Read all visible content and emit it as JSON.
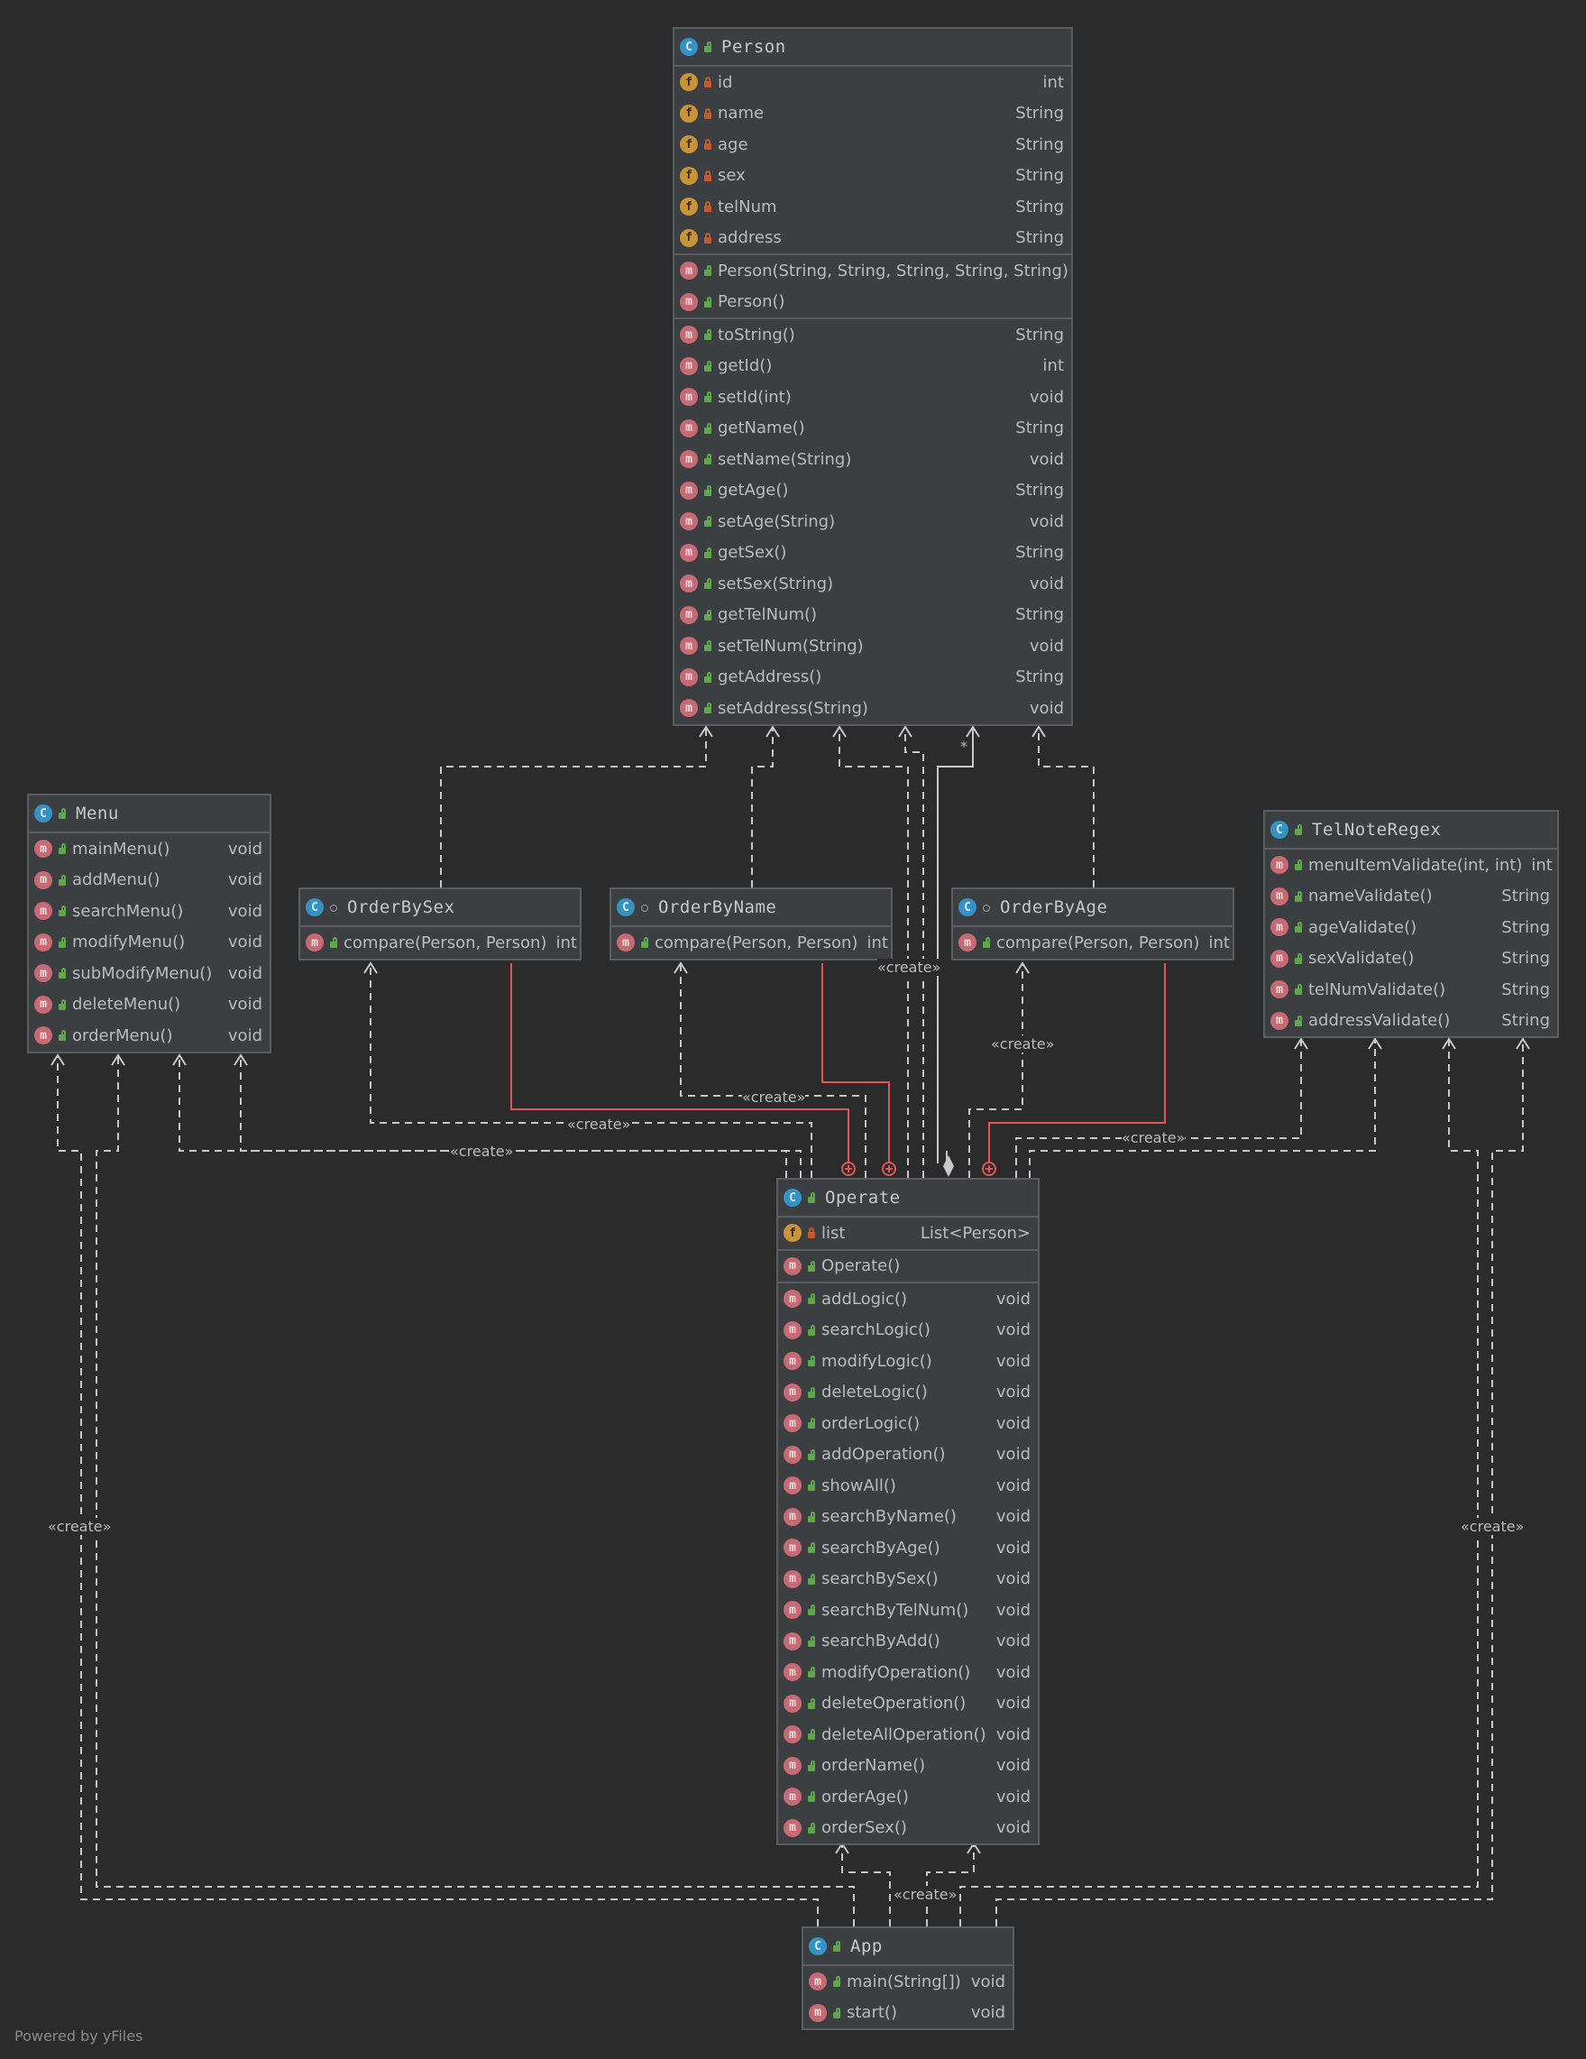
{
  "classes": {
    "person": {
      "name": "Person",
      "fields": [
        {
          "name": "id",
          "type": "int"
        },
        {
          "name": "name",
          "type": "String"
        },
        {
          "name": "age",
          "type": "String"
        },
        {
          "name": "sex",
          "type": "String"
        },
        {
          "name": "telNum",
          "type": "String"
        },
        {
          "name": "address",
          "type": "String"
        }
      ],
      "constructors": [
        {
          "name": "Person(String, String, String, String, String)",
          "type": ""
        },
        {
          "name": "Person()",
          "type": ""
        }
      ],
      "methods": [
        {
          "name": "toString()",
          "type": "String"
        },
        {
          "name": "getId()",
          "type": "int"
        },
        {
          "name": "setId(int)",
          "type": "void"
        },
        {
          "name": "getName()",
          "type": "String"
        },
        {
          "name": "setName(String)",
          "type": "void"
        },
        {
          "name": "getAge()",
          "type": "String"
        },
        {
          "name": "setAge(String)",
          "type": "void"
        },
        {
          "name": "getSex()",
          "type": "String"
        },
        {
          "name": "setSex(String)",
          "type": "void"
        },
        {
          "name": "getTelNum()",
          "type": "String"
        },
        {
          "name": "setTelNum(String)",
          "type": "void"
        },
        {
          "name": "getAddress()",
          "type": "String"
        },
        {
          "name": "setAddress(String)",
          "type": "void"
        }
      ]
    },
    "menu": {
      "name": "Menu",
      "methods": [
        {
          "name": "mainMenu()",
          "type": "void"
        },
        {
          "name": "addMenu()",
          "type": "void"
        },
        {
          "name": "searchMenu()",
          "type": "void"
        },
        {
          "name": "modifyMenu()",
          "type": "void"
        },
        {
          "name": "subModifyMenu()",
          "type": "void"
        },
        {
          "name": "deleteMenu()",
          "type": "void"
        },
        {
          "name": "orderMenu()",
          "type": "void"
        }
      ]
    },
    "order_by_sex": {
      "name": "OrderBySex",
      "methods": [
        {
          "name": "compare(Person, Person)",
          "type": "int"
        }
      ]
    },
    "order_by_name": {
      "name": "OrderByName",
      "methods": [
        {
          "name": "compare(Person, Person)",
          "type": "int"
        }
      ]
    },
    "order_by_age": {
      "name": "OrderByAge",
      "methods": [
        {
          "name": "compare(Person, Person)",
          "type": "int"
        }
      ]
    },
    "tel_note_regex": {
      "name": "TelNoteRegex",
      "methods": [
        {
          "name": "menuItemValidate(int, int)",
          "type": "int"
        },
        {
          "name": "nameValidate()",
          "type": "String"
        },
        {
          "name": "ageValidate()",
          "type": "String"
        },
        {
          "name": "sexValidate()",
          "type": "String"
        },
        {
          "name": "telNumValidate()",
          "type": "String"
        },
        {
          "name": "addressValidate()",
          "type": "String"
        }
      ]
    },
    "operate": {
      "name": "Operate",
      "fields": [
        {
          "name": "list",
          "type": "List<Person>"
        }
      ],
      "constructors": [
        {
          "name": "Operate()",
          "type": ""
        }
      ],
      "methods": [
        {
          "name": "addLogic()",
          "type": "void"
        },
        {
          "name": "searchLogic()",
          "type": "void"
        },
        {
          "name": "modifyLogic()",
          "type": "void"
        },
        {
          "name": "deleteLogic()",
          "type": "void"
        },
        {
          "name": "orderLogic()",
          "type": "void"
        },
        {
          "name": "addOperation()",
          "type": "void"
        },
        {
          "name": "showAll()",
          "type": "void"
        },
        {
          "name": "searchByName()",
          "type": "void"
        },
        {
          "name": "searchByAge()",
          "type": "void"
        },
        {
          "name": "searchBySex()",
          "type": "void"
        },
        {
          "name": "searchByTelNum()",
          "type": "void"
        },
        {
          "name": "searchByAdd()",
          "type": "void"
        },
        {
          "name": "modifyOperation()",
          "type": "void"
        },
        {
          "name": "deleteOperation()",
          "type": "void"
        },
        {
          "name": "deleteAllOperation()",
          "type": "void"
        },
        {
          "name": "orderName()",
          "type": "void"
        },
        {
          "name": "orderAge()",
          "type": "void"
        },
        {
          "name": "orderSex()",
          "type": "void"
        }
      ]
    },
    "app": {
      "name": "App",
      "methods": [
        {
          "name": "main(String[])",
          "type": "void"
        },
        {
          "name": "start()",
          "type": "void"
        }
      ]
    }
  },
  "icons": {
    "class": "C",
    "field": "f",
    "method": "m"
  },
  "edge_labels": {
    "create": "«create»",
    "multiplicity": "*"
  },
  "footer": "Powered by yFiles",
  "colors": {
    "background": "#2b2b2b",
    "node": "#3c3f41",
    "border": "#5b5e60",
    "edge": "#c8c8c8",
    "inner_class_edge": "#e05555"
  }
}
